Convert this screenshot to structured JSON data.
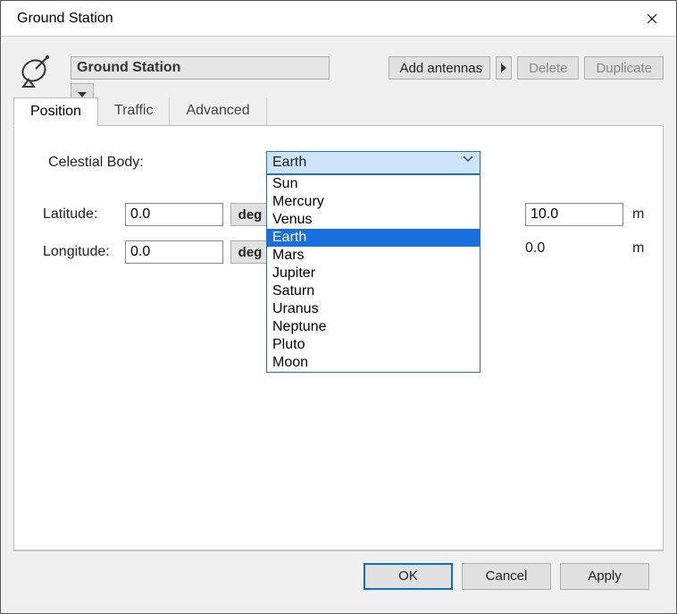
{
  "window": {
    "title": "Ground Station"
  },
  "header": {
    "station_name": "Ground Station",
    "add_antennas": "Add antennas",
    "delete": "Delete",
    "duplicate": "Duplicate"
  },
  "tabs": [
    {
      "label": "Position"
    },
    {
      "label": "Traffic"
    },
    {
      "label": "Advanced"
    }
  ],
  "position": {
    "celestial_body_label": "Celestial Body:",
    "celestial_body_selected": "Earth",
    "celestial_body_options": [
      "Sun",
      "Mercury",
      "Venus",
      "Earth",
      "Mars",
      "Jupiter",
      "Saturn",
      "Uranus",
      "Neptune",
      "Pluto",
      "Moon"
    ],
    "latitude_label": "Latitude:",
    "latitude_value": "0.0",
    "latitude_unit": "deg",
    "longitude_label": "Longitude:",
    "longitude_value": "0.0",
    "longitude_unit": "deg",
    "altitude_value": "10.0",
    "altitude_unit": "m",
    "second_right_value": "0.0",
    "second_right_unit": "m"
  },
  "footer": {
    "ok": "OK",
    "cancel": "Cancel",
    "apply": "Apply"
  }
}
